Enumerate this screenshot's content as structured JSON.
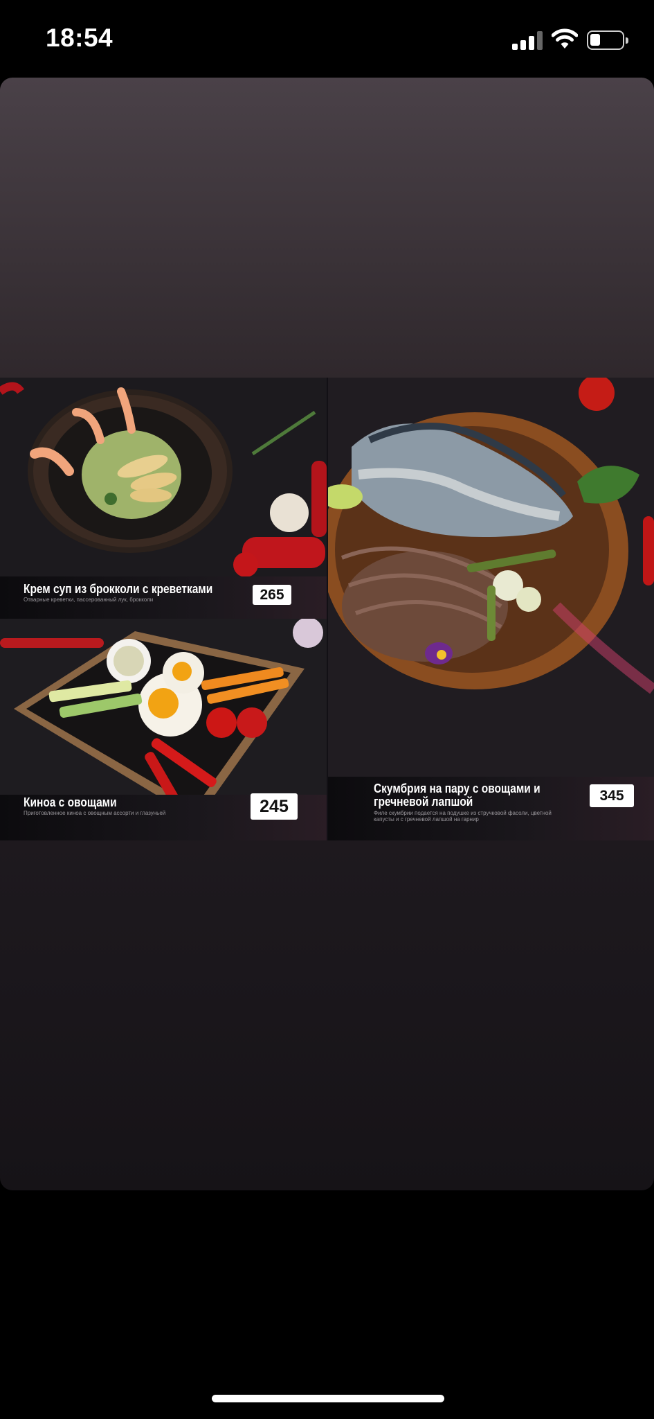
{
  "status_bar": {
    "time": "18:54",
    "icons": [
      "cellular-signal-icon",
      "wifi-icon",
      "battery-icon"
    ]
  },
  "menu": {
    "items": [
      {
        "name": "Крем суп из брокколи с креветками",
        "description": "Отварные креветки, пассерованный лук, брокколи",
        "price": "265"
      },
      {
        "name": "Киноа с овощами",
        "description": "Приготовленное киноа с овощным ассорти и глазуньей",
        "price": "245"
      },
      {
        "name": "Скумбрия на пару с овощами и гречневой лапшой",
        "description": "Филе скумбрии подается на подушке из стручковой фасоли, цветной капусты и с гречневой лапшой на гарнир",
        "price": "345"
      }
    ]
  },
  "colors": {
    "background": "#000000",
    "viewer_top": "#4a4148",
    "viewer_bottom": "#161317",
    "price_tag": "#ffffff"
  }
}
